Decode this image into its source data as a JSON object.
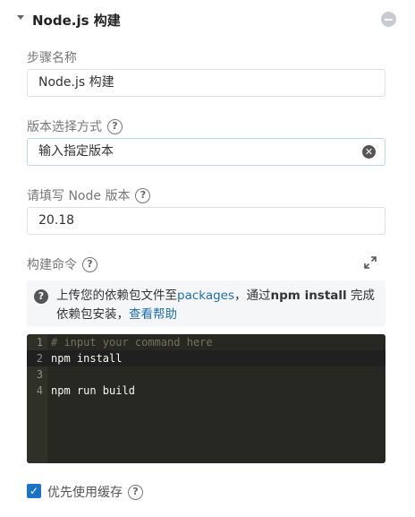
{
  "section": {
    "title": "Node.js 构建",
    "remove_icon": "minus-circle-icon",
    "collapse_icon": "caret-down-icon"
  },
  "step_name": {
    "label": "步骤名称",
    "value": "Node.js 构建"
  },
  "version_mode": {
    "label": "版本选择方式",
    "help_icon": "question-circle-icon",
    "value": "输入指定版本",
    "clear_icon": "clear-circle-icon"
  },
  "node_version": {
    "label": "请填写 Node 版本",
    "help_icon": "question-circle-icon",
    "value": "20.18"
  },
  "build_command": {
    "label": "构建命令",
    "help_icon": "question-circle-icon",
    "expand_icon": "fullscreen-icon",
    "info": {
      "icon": "question-circle-icon",
      "text_1": "上传您的依赖包文件至",
      "link_packages": "packages",
      "text_2": "，通过",
      "bold_cmd": "npm install",
      "text_3": " 完成依赖包安装，",
      "link_view_help": "查看帮助"
    },
    "editor": {
      "lines": [
        {
          "number": "1",
          "text": "# input your command here"
        },
        {
          "number": "2",
          "text": "npm install"
        },
        {
          "number": "3",
          "text": ""
        },
        {
          "number": "4",
          "text": "npm run build"
        }
      ],
      "colors": {
        "background": "#272822",
        "comment": "#75715e",
        "text": "#f8f8f2"
      }
    }
  },
  "cache": {
    "label": "优先使用缓存",
    "checked": true,
    "help_icon": "question-circle-icon"
  },
  "colors": {
    "accent": "#1a73c7",
    "link": "#1f6fb2"
  }
}
